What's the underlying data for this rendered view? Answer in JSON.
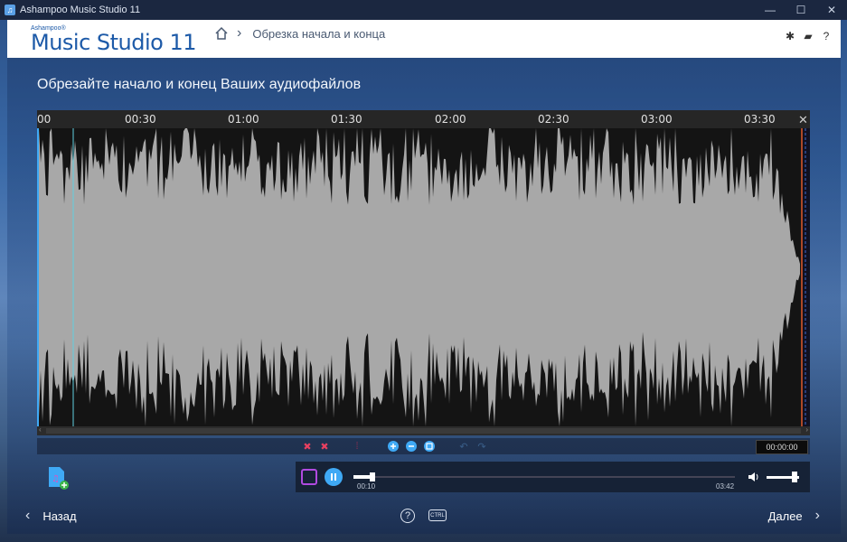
{
  "window": {
    "title": "Ashampoo Music Studio 11",
    "controls": [
      "minimize-icon",
      "maximize-icon",
      "close-icon"
    ]
  },
  "header": {
    "brand_small": "Ashampoo®",
    "brand_big": "Music Studio 11",
    "breadcrumb": "Обрезка начала и конца",
    "icons": [
      "gear-icon",
      "info-card-icon",
      "help-icon"
    ],
    "help_label": "?"
  },
  "heading": "Обрезайте начало и конец Ваших аудиофайлов",
  "ruler": {
    "ticks": [
      "00",
      "00:30",
      "01:00",
      "01:30",
      "02:00",
      "02:30",
      "03:00",
      "03:30"
    ]
  },
  "toolbar": {
    "time_display": "00:00:00"
  },
  "player": {
    "position": "00:10",
    "duration": "03:42",
    "progress": 0.05,
    "volume": 0.9
  },
  "footer": {
    "back_label": "Назад",
    "next_label": "Далее",
    "help_label": "?",
    "ctrl_label": "CTRL"
  },
  "colors": {
    "accent": "#3fa9f5",
    "brand": "#1d5aa8",
    "marker": "#e05a2a",
    "wave": "#a8a8a8"
  }
}
